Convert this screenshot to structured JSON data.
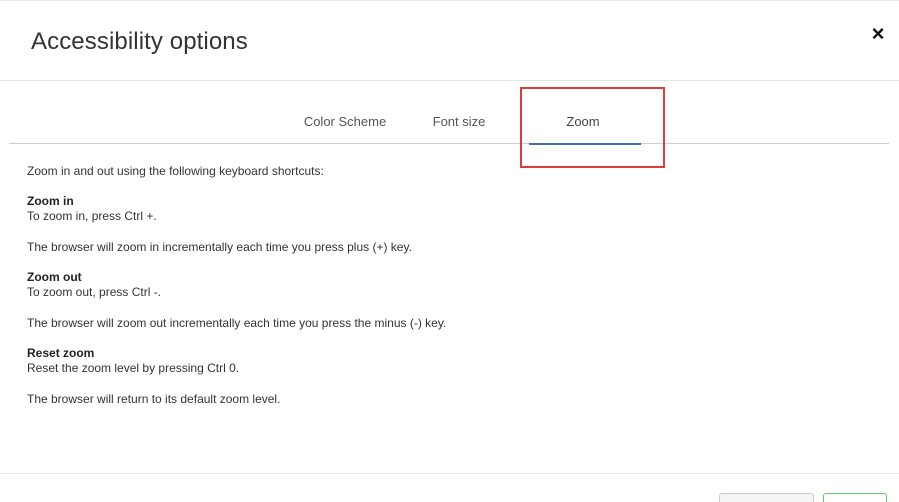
{
  "dialog": {
    "title": "Accessibility options",
    "close_icon": "close-icon",
    "close_glyph": "×"
  },
  "tabs": [
    {
      "label": "Color Scheme",
      "active": false
    },
    {
      "label": "Font size",
      "active": false
    },
    {
      "label": "Zoom",
      "active": true
    }
  ],
  "content": {
    "intro": "Zoom in and out using the following keyboard shortcuts:",
    "sections": [
      {
        "heading": "Zoom in",
        "shortcut": "To zoom in, press Ctrl +.",
        "detail": "The browser will zoom in incrementally each time you press plus (+) key."
      },
      {
        "heading": "Zoom out",
        "shortcut": "To zoom out, press Ctrl -.",
        "detail": "The browser will zoom out incrementally each time you press the minus (-) key."
      },
      {
        "heading": "Reset zoom",
        "shortcut": "Reset the zoom level by pressing Ctrl 0.",
        "detail": "The browser will return to its default zoom level."
      }
    ]
  },
  "colors": {
    "active_tab_underline": "#3b6fb6",
    "annotation_highlight": "#e03a3a",
    "primary_button_border": "#6cc070"
  }
}
